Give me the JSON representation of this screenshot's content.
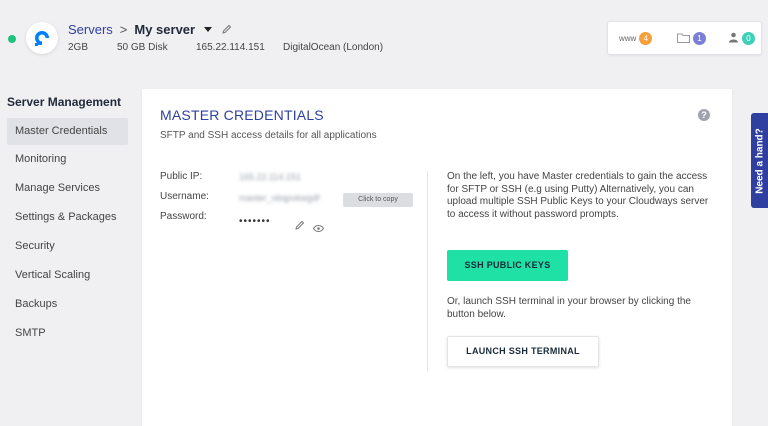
{
  "header": {
    "breadcrumb_root": "Servers",
    "breadcrumb_sep": ">",
    "server_name": "My server",
    "server_meta": {
      "ram": "2GB",
      "disk": "50 GB Disk",
      "ip": "165.22.114.151",
      "provider": "DigitalOcean (London)"
    },
    "stats": {
      "www_label": "www",
      "www_count": "4",
      "folder_count": "1",
      "users_count": "0"
    }
  },
  "sidebar": {
    "title": "Server Management",
    "items": [
      {
        "label": "Master Credentials",
        "active": true
      },
      {
        "label": "Monitoring"
      },
      {
        "label": "Manage Services"
      },
      {
        "label": "Settings & Packages"
      },
      {
        "label": "Security"
      },
      {
        "label": "Vertical Scaling"
      },
      {
        "label": "Backups"
      },
      {
        "label": "SMTP"
      }
    ]
  },
  "card": {
    "title": "MASTER CREDENTIALS",
    "subtitle": "SFTP and SSH access details for all applications",
    "help": "?",
    "public_ip_label": "Public IP:",
    "public_ip_value": "165.22.114.151",
    "username_label": "Username:",
    "username_value": "master_nbqpvkwgdf",
    "copy_tooltip": "Click to copy",
    "password_label": "Password:",
    "password_value": "•••••••",
    "info_text": "On the left, you have Master credentials to gain the access for SFTP or SSH (e.g using Putty) Alternatively, you can upload multiple SSH Public Keys to your Cloudways server to access it without password prompts.",
    "ssh_keys_button": "SSH PUBLIC KEYS",
    "launch_text": "Or, launch SSH terminal in your browser by clicking the button below.",
    "launch_button": "LAUNCH SSH TERMINAL"
  },
  "help_tab": "Need a hand?",
  "colors": {
    "accent": "#2f3fa0",
    "button_green": "#1fe0a5",
    "status_online": "#1fc27a"
  }
}
